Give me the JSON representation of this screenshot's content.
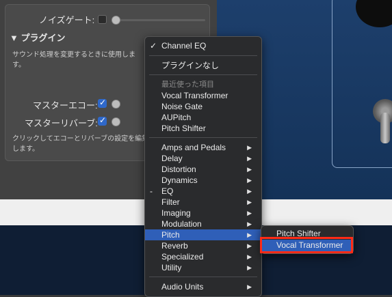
{
  "panel": {
    "noise_gate_label": "ノイズゲート:",
    "plugins_title": "▼ プラグイン",
    "plugins_desc": "サウンド処理を変更するときに使用します。",
    "master_echo_label": "マスターエコー:",
    "master_reverb_label": "マスターリバーブ:",
    "help_text": "クリックしてエコーとリバーブの設定を編集します。"
  },
  "menu": {
    "checked_item": "Channel EQ",
    "check_mark": "✓",
    "no_plugin": "プラグインなし",
    "recent_header": "最近使った項目",
    "recent": [
      "Vocal Transformer",
      "Noise Gate",
      "AUPitch",
      "Pitch Shifter"
    ],
    "categories": [
      "Amps and Pedals",
      "Delay",
      "Distortion",
      "Dynamics",
      "EQ",
      "Filter",
      "Imaging",
      "Modulation",
      "Pitch",
      "Reverb",
      "Specialized",
      "Utility"
    ],
    "eq_marker": "-",
    "audio_units": "Audio Units",
    "arrow_glyph": "▶",
    "selected_category": "Pitch"
  },
  "submenu": {
    "items": [
      "Pitch Shifter",
      "Vocal Transformer"
    ],
    "selected": "Vocal Transformer"
  },
  "colors": {
    "highlight": "#ff2b17",
    "selection": "#2f5fb8"
  }
}
